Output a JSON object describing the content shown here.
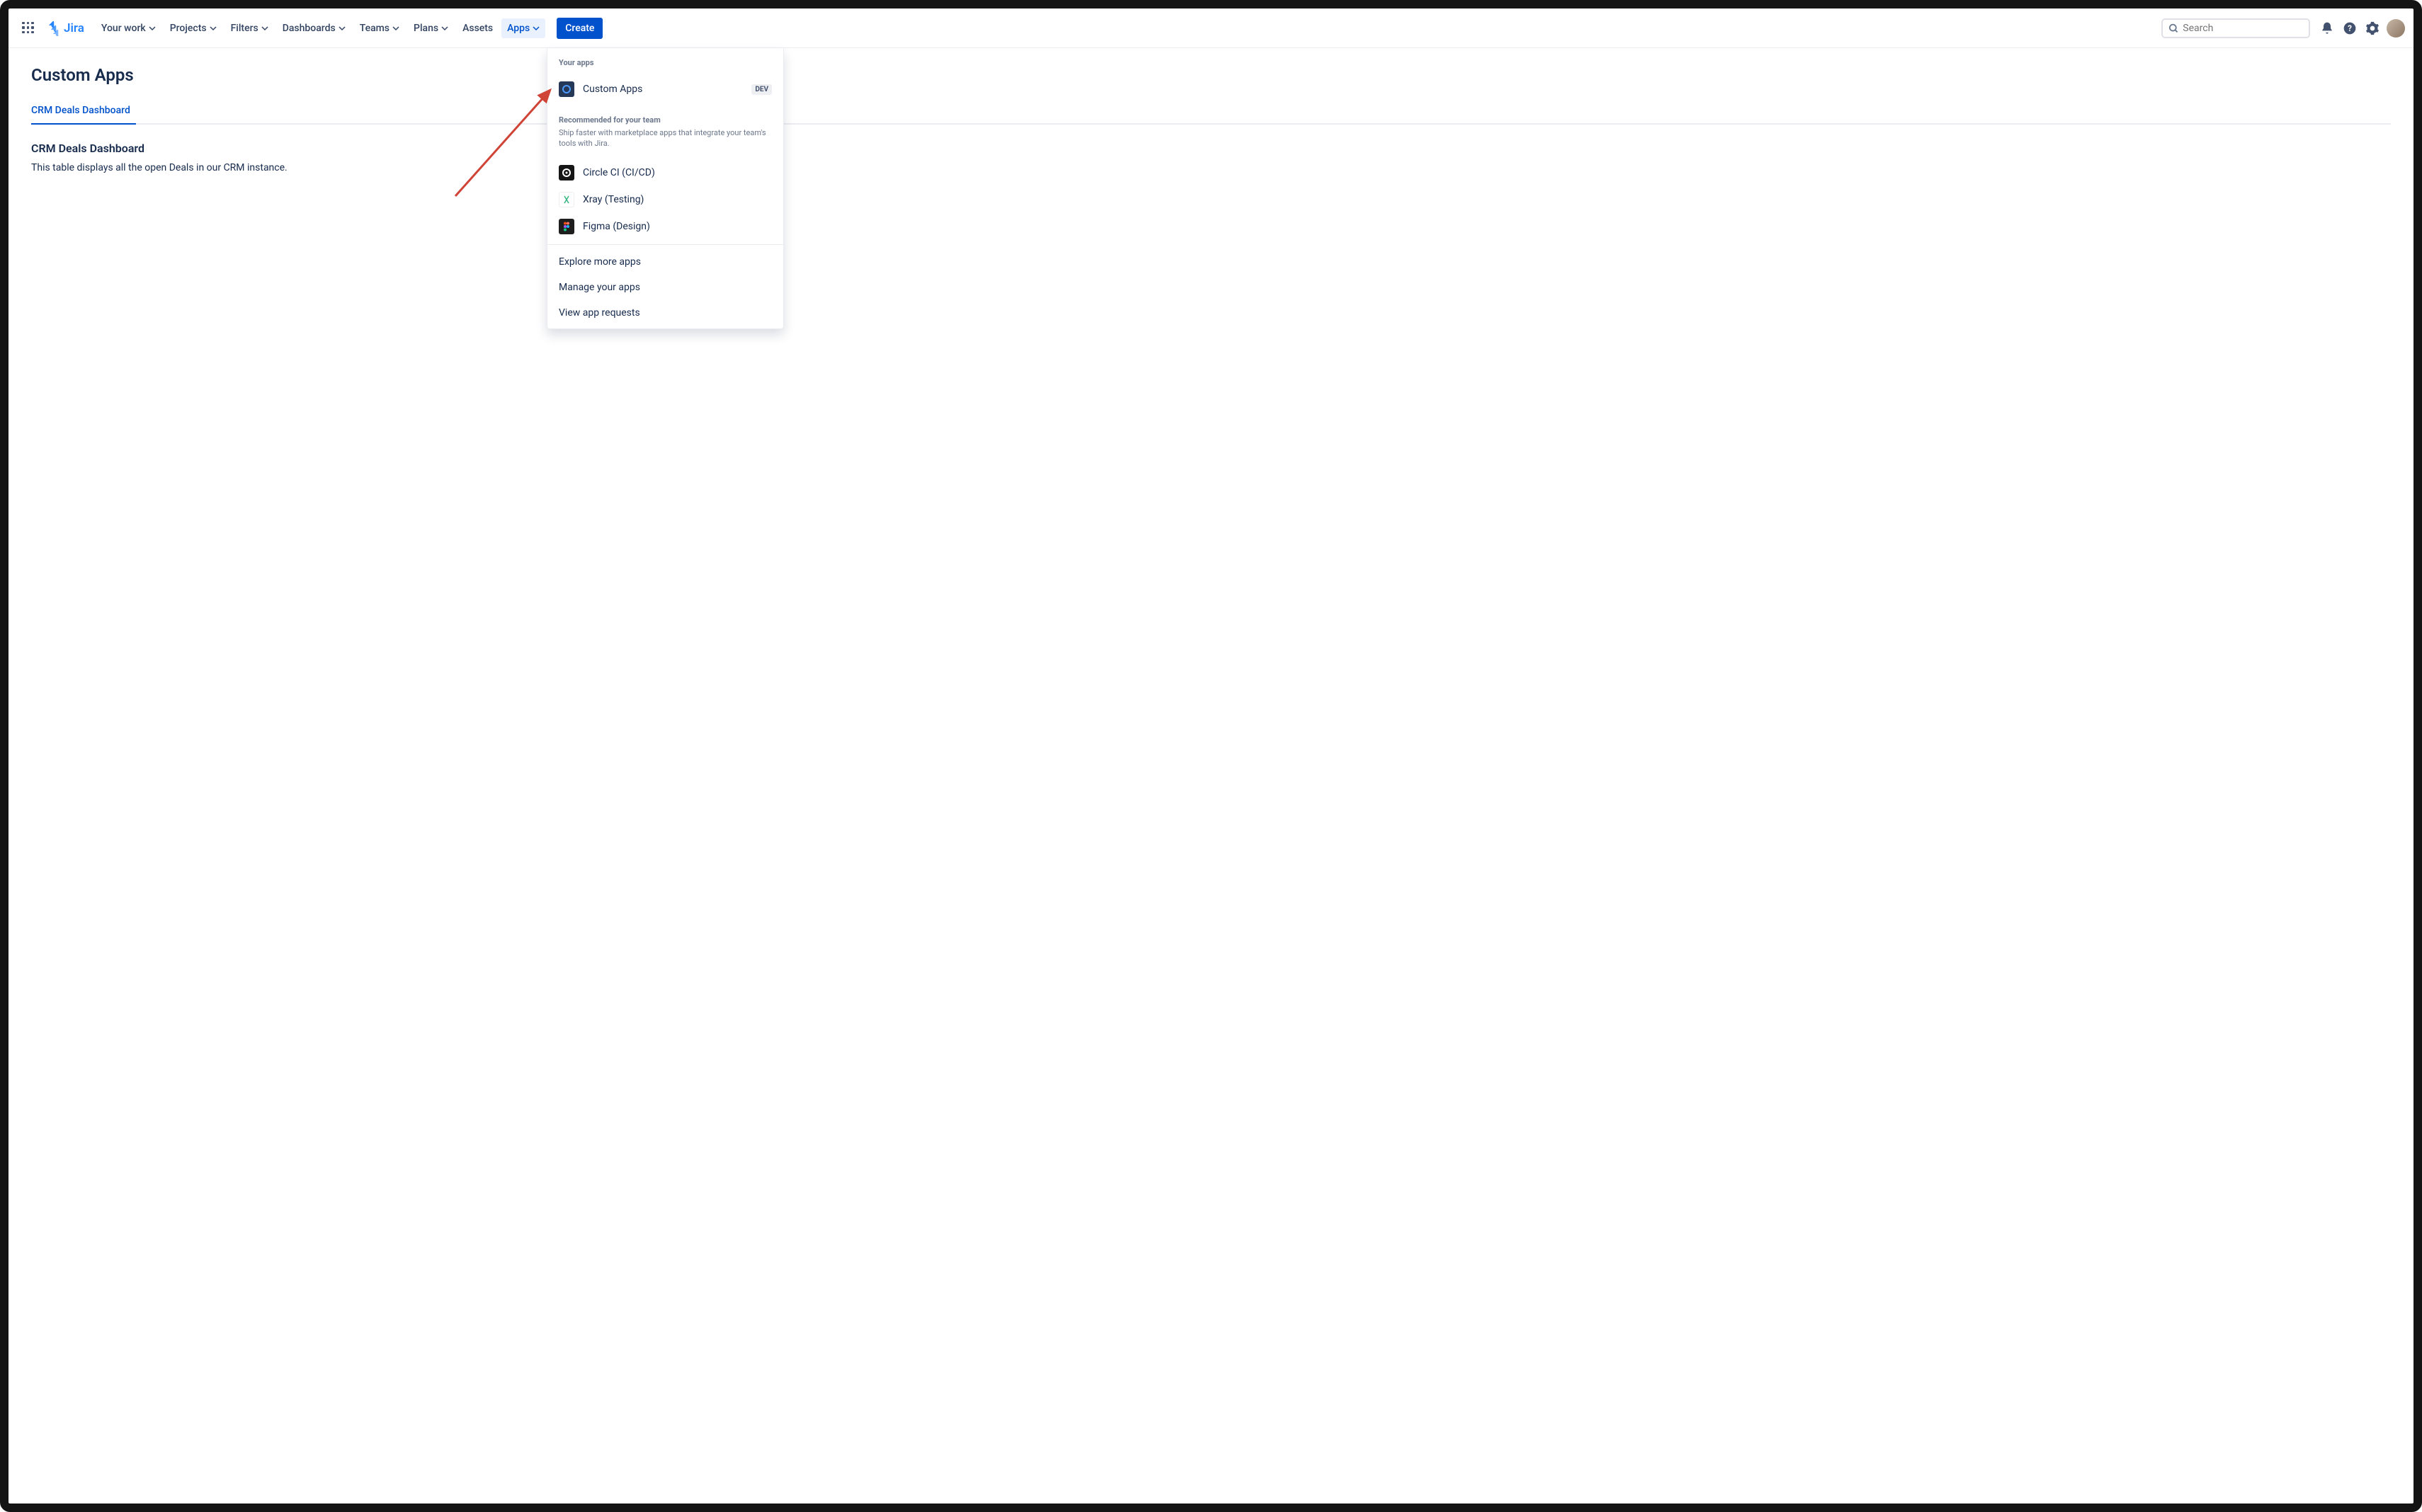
{
  "header": {
    "product_name": "Jira",
    "nav": {
      "your_work": "Your work",
      "projects": "Projects",
      "filters": "Filters",
      "dashboards": "Dashboards",
      "teams": "Teams",
      "plans": "Plans",
      "assets": "Assets",
      "apps": "Apps"
    },
    "create_label": "Create",
    "search_placeholder": "Search"
  },
  "page": {
    "title": "Custom Apps",
    "tab_label": "CRM Deals Dashboard",
    "section_heading": "CRM Deals Dashboard",
    "section_text": "This table displays all the open Deals in our CRM instance."
  },
  "apps_dropdown": {
    "your_apps_heading": "Your apps",
    "your_apps": [
      {
        "label": "Custom Apps",
        "badge": "DEV"
      }
    ],
    "recommended_heading": "Recommended for your team",
    "recommended_subtext": "Ship faster with marketplace apps that integrate your team's tools with Jira.",
    "recommended": [
      {
        "label": "Circle CI (CI/CD)"
      },
      {
        "label": "Xray (Testing)"
      },
      {
        "label": "Figma (Design)"
      }
    ],
    "links": {
      "explore": "Explore more apps",
      "manage": "Manage your apps",
      "requests": "View app requests"
    }
  }
}
